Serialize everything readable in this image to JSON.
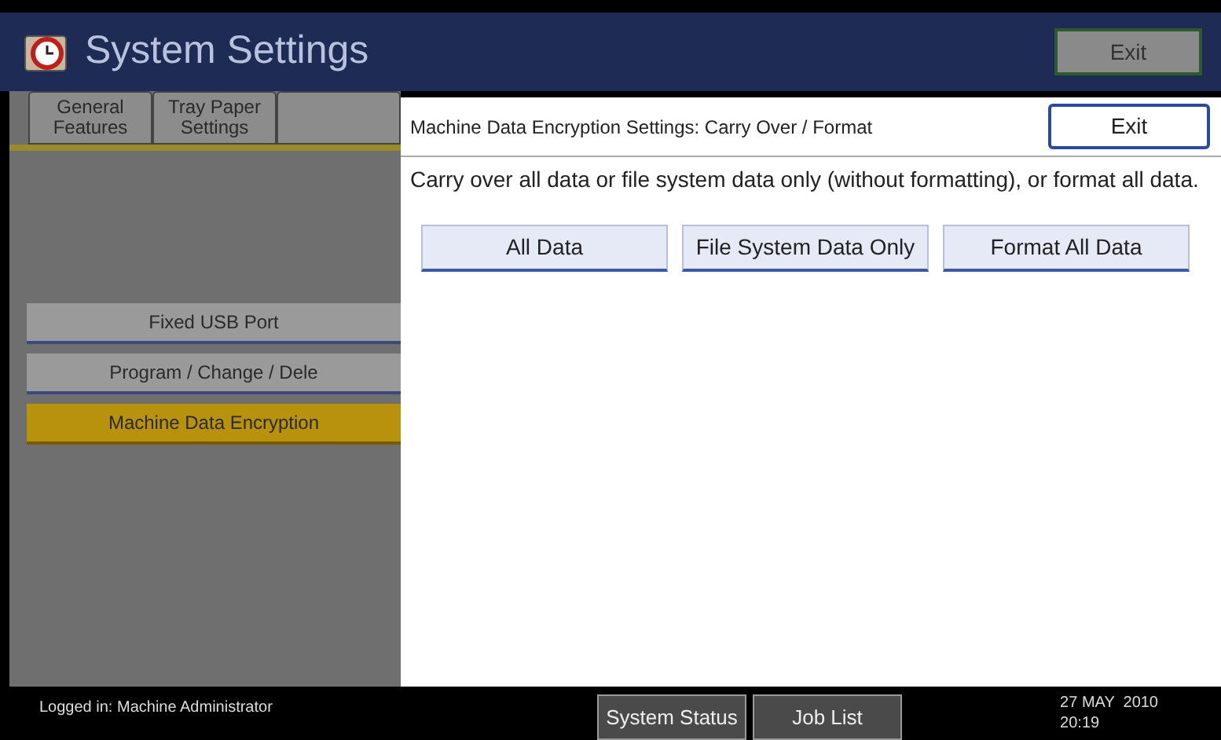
{
  "header": {
    "title": "System Settings",
    "exit_label": "Exit"
  },
  "tabs": [
    {
      "label": "General Features",
      "selected": false
    },
    {
      "label": "Tray Paper Settings",
      "selected": false
    },
    {
      "selected": false
    }
  ],
  "menu_items": [
    {
      "label": "Fixed USB Port",
      "selected": false
    },
    {
      "label": "Program / Change / Dele",
      "selected": false
    },
    {
      "label": "Machine Data Encryption",
      "selected": true
    }
  ],
  "dialog": {
    "title": "Machine Data Encryption Settings: Carry Over / Format",
    "exit_label": "Exit",
    "message": "Carry over all data or file system data only (without formatting), or format all data.",
    "buttons": [
      "All Data",
      "File System Data Only",
      "Format All Data"
    ]
  },
  "status_bar": {
    "login": "Logged in: Machine Administrator",
    "buttons": [
      "System Status",
      "Job List"
    ],
    "date": "27 MAY  2010",
    "time": "20:19"
  }
}
